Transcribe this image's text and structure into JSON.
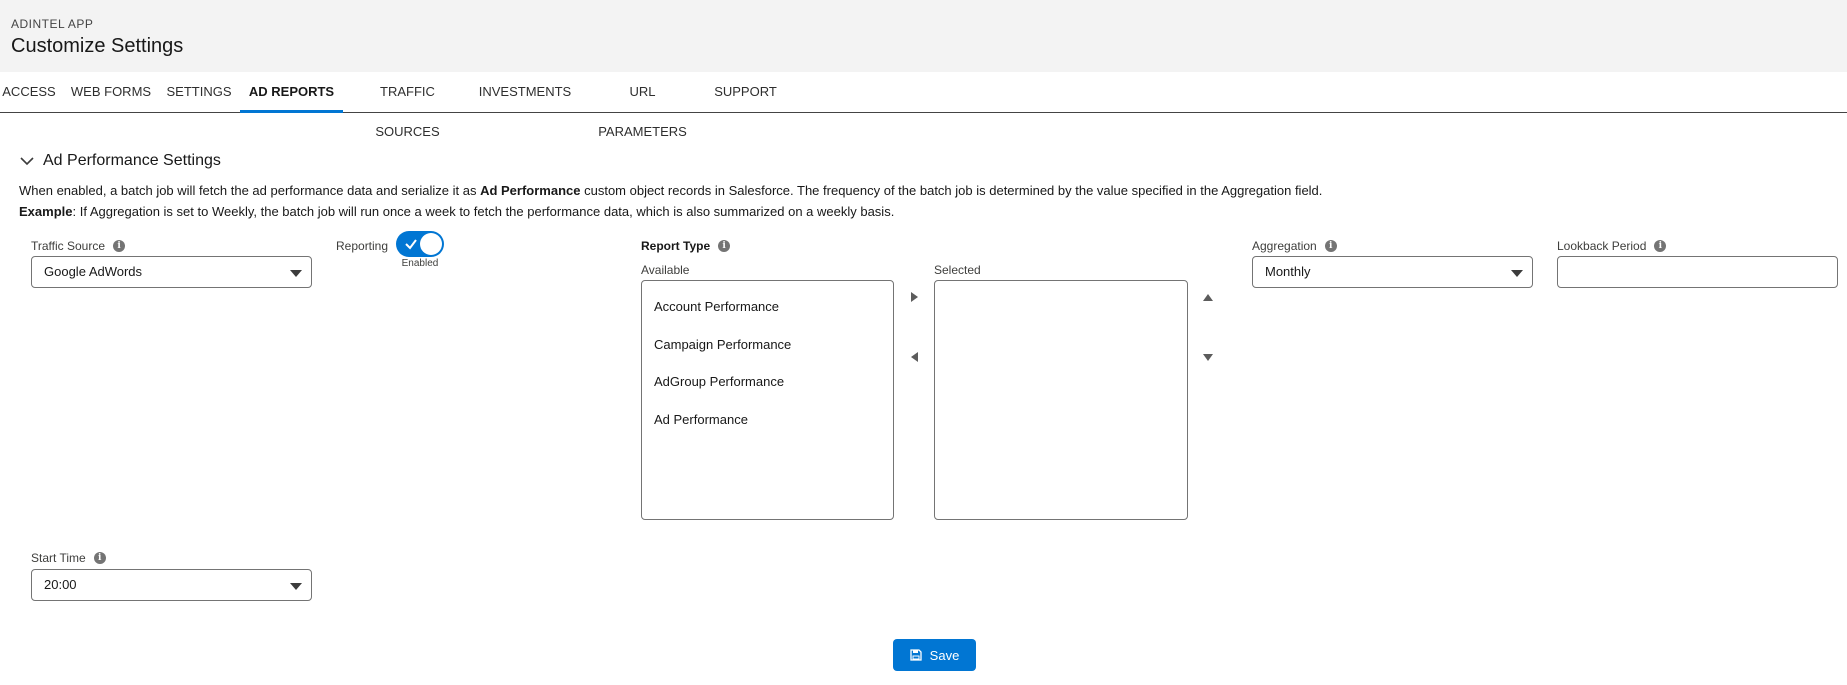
{
  "header": {
    "app_name": "ADINTEL APP",
    "title": "Customize Settings"
  },
  "tabs": [
    {
      "label": "ACCESS",
      "active": false
    },
    {
      "label": "WEB FORMS",
      "active": false
    },
    {
      "label": "SETTINGS",
      "active": false
    },
    {
      "label": "AD REPORTS",
      "active": true
    },
    {
      "label": "TRAFFIC SOURCES",
      "active": false
    },
    {
      "label": "INVESTMENTS",
      "active": false
    },
    {
      "label": "URL PARAMETERS",
      "active": false
    },
    {
      "label": "SUPPORT",
      "active": false
    }
  ],
  "section": {
    "title": "Ad Performance Settings",
    "description": {
      "pre": "When enabled, a batch job will fetch the ad performance data and serialize it as ",
      "bold": "Ad Performance",
      "post": " custom object records in Salesforce. The frequency of the batch job is determined by the value specified in the Aggregation field."
    },
    "example": {
      "label": "Example",
      "text": ": If Aggregation is set to Weekly, the batch job will run once a week to fetch the performance data, which is also summarized on a weekly basis."
    }
  },
  "fields": {
    "traffic_source": {
      "label": "Traffic Source",
      "value": "Google AdWords"
    },
    "reporting": {
      "label": "Reporting",
      "enabled": true,
      "status": "Enabled"
    },
    "report_type": {
      "label": "Report Type",
      "available_label": "Available",
      "selected_label": "Selected",
      "available": [
        "Account Performance",
        "Campaign Performance",
        "AdGroup Performance",
        "Ad Performance"
      ],
      "selected": []
    },
    "aggregation": {
      "label": "Aggregation",
      "value": "Monthly"
    },
    "lookback_period": {
      "label": "Lookback Period",
      "value": ""
    },
    "start_time": {
      "label": "Start Time",
      "value": "20:00"
    }
  },
  "actions": {
    "save_label": "Save"
  },
  "icons": {
    "info": "info-icon",
    "chevron": "chevron-down-icon",
    "save": "save-icon",
    "check": "check-icon"
  },
  "colors": {
    "brand": "#0176d3",
    "header_bg": "#f3f3f3",
    "border": "#747474"
  }
}
